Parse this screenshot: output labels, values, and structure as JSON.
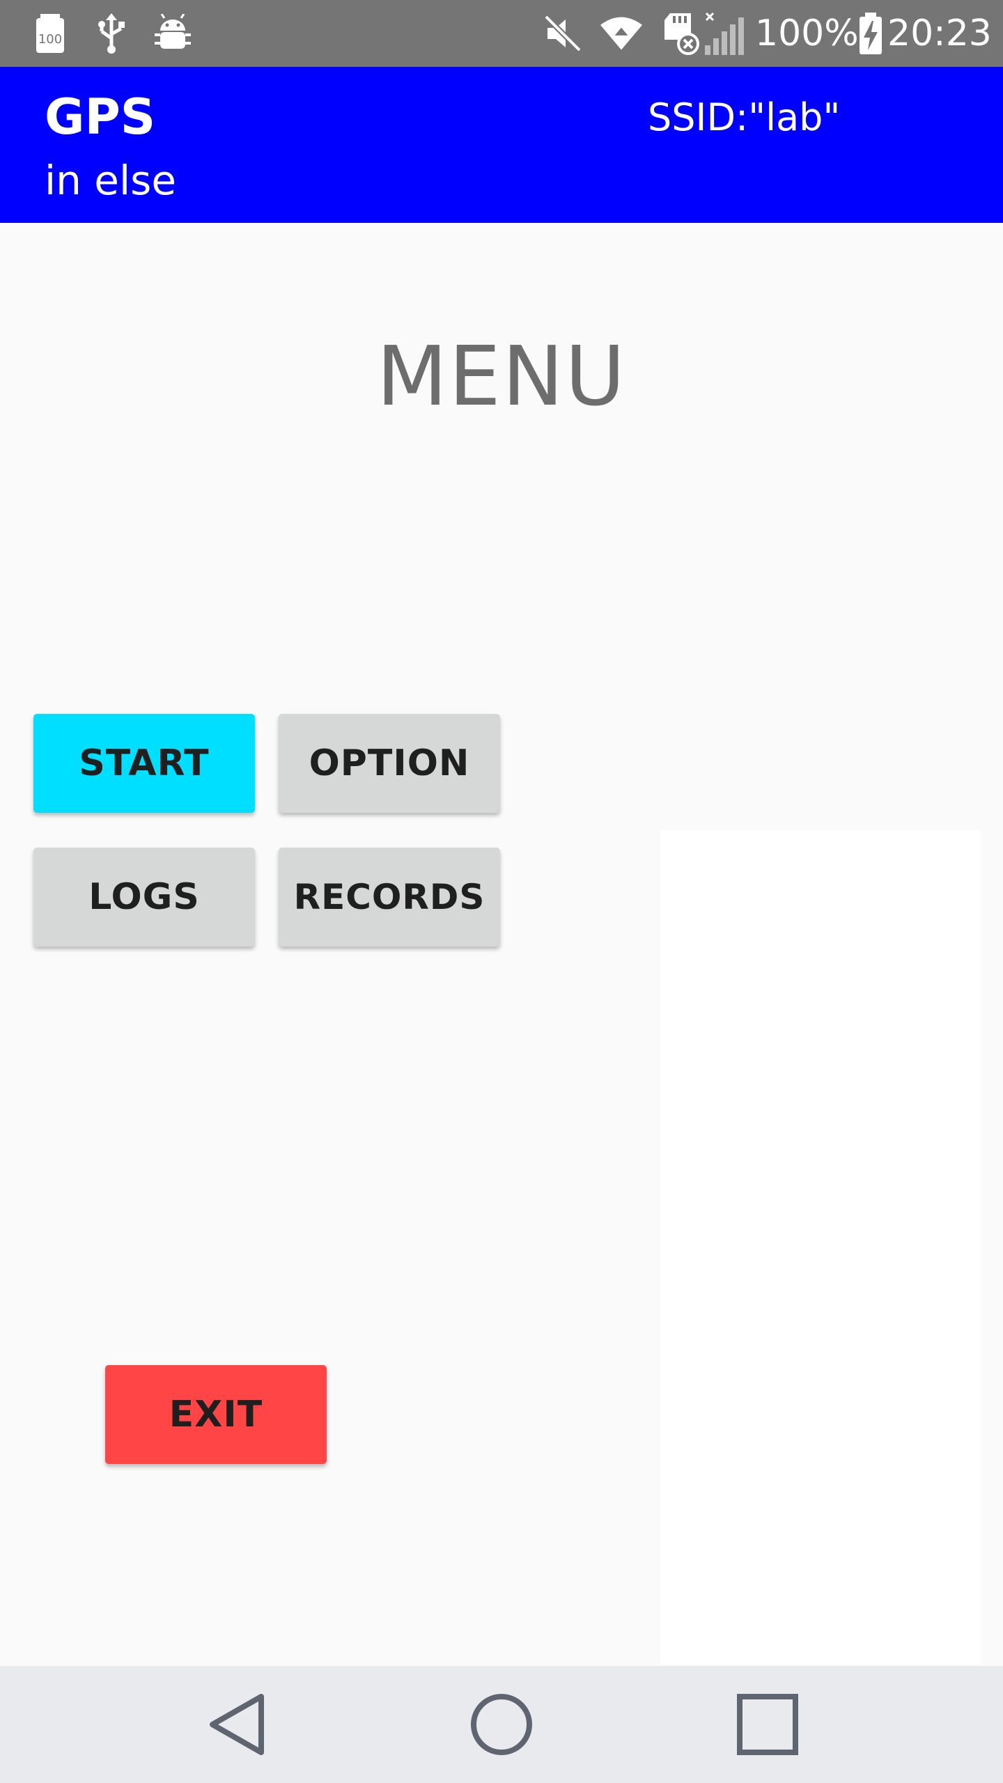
{
  "status_bar": {
    "battery_percent": "100%",
    "time": "20:23",
    "icons": [
      "battery-100-icon",
      "usb-icon",
      "android-debug-icon",
      "mute-icon",
      "wifi-icon",
      "sd-card-error-icon",
      "signal-icon",
      "battery-charging-icon"
    ]
  },
  "app_bar": {
    "title": "GPS",
    "subtitle": "in else",
    "ssid": "SSID:\"lab\"",
    "background_color": "#0000ff"
  },
  "main": {
    "heading": "MENU",
    "buttons": {
      "start": "START",
      "option": "OPTION",
      "logs": "LOGS",
      "records": "RECORDS",
      "exit": "EXIT"
    },
    "colors": {
      "start": "#00dfff",
      "default": "#d6d7d7",
      "exit": "#ff4545"
    }
  },
  "nav_bar": {
    "icons": [
      "back-icon",
      "home-icon",
      "recents-icon"
    ]
  }
}
